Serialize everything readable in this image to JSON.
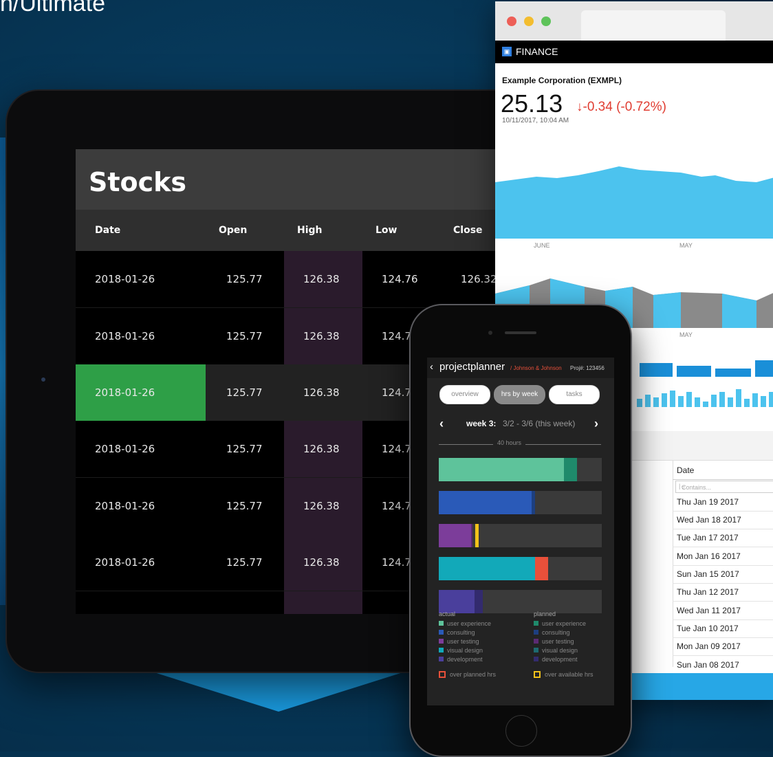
{
  "headline": "n/Ultimate",
  "tablet": {
    "title": "Stocks",
    "columns": [
      "Date",
      "Open",
      "High",
      "Low",
      "Close"
    ],
    "rows": [
      {
        "date": "2018-01-26",
        "open": "125.77",
        "high": "126.38",
        "low": "124.76",
        "close": "126.32"
      },
      {
        "date": "2018-01-26",
        "open": "125.77",
        "high": "126.38",
        "low": "124.76"
      },
      {
        "date": "2018-01-26",
        "open": "125.77",
        "high": "126.38",
        "low": "124.76"
      },
      {
        "date": "2018-01-26",
        "open": "125.77",
        "high": "126.38",
        "low": "124.76"
      },
      {
        "date": "2018-01-26",
        "open": "125.77",
        "high": "126.38",
        "low": "124.76"
      },
      {
        "date": "2018-01-26",
        "open": "125.77",
        "high": "126.38",
        "low": "124.76"
      }
    ],
    "selected_row": 2,
    "colors": {
      "selected": "#2e9f47",
      "high_column": "#2a1b2c"
    }
  },
  "browser": {
    "app_icon": "finance-logo-icon",
    "app_name": "FINANCE",
    "company": "Example Corporation (EXMPL)",
    "price": "25.13",
    "change_arrow": "↓",
    "change": "-0.34 (-0.72%)",
    "timestamp": "10/11/2017, 10:04 AM",
    "month_labels": {
      "top_left": "JUNE",
      "top_right": "MAY",
      "bottom": "MAY"
    },
    "grid": {
      "column": "Date",
      "filter_icon": "filter-icon",
      "filter_placeholder": "Contains...",
      "dates": [
        "Thu Jan 19 2017",
        "Wed Jan 18 2017",
        "Tue Jan 17 2017",
        "Mon Jan 16 2017",
        "Sun Jan 15 2017",
        "Thu Jan 12 2017",
        "Wed Jan 11 2017",
        "Tue Jan 10 2017",
        "Mon Jan 09 2017",
        "Sun Jan 08 2017"
      ]
    },
    "colors": {
      "chart": "#4cc3ee",
      "negative": "#e03c31",
      "footer": "#27a7e6"
    }
  },
  "phone": {
    "app_title": "projectplanner",
    "client": "/ Johnson & Johnson",
    "project": "Proj#: 123456",
    "tabs": [
      "overview",
      "hrs by week",
      "tasks"
    ],
    "active_tab": 1,
    "week_label": "week 3:",
    "week_range": "3/2 - 3/6 (this week)",
    "capacity_label": "40 hours",
    "bars": [
      {
        "actual": 0.77,
        "planned_end": 0.85,
        "actual_color": "#5ec39b",
        "planned_color": "#1f8a6b"
      },
      {
        "actual": 0.57,
        "planned_end": 0.59,
        "actual_color": "#2a5ab8",
        "planned_color": "#1d3f80"
      },
      {
        "actual": 0.2,
        "planned_end": 0.21,
        "actual_color": "#7c3d9a",
        "planned_color": "#5b2a73",
        "overflow_color": "#f2c21a"
      },
      {
        "actual": 0.59,
        "planned_end": 0.67,
        "actual_color": "#12a9b9",
        "planned_color": "#e8503a"
      },
      {
        "actual": 0.22,
        "planned_end": 0.27,
        "actual_color": "#4a3f9c",
        "planned_color": "#332b6e"
      }
    ],
    "legend": {
      "actual_title": "actual",
      "planned_title": "planned",
      "items": [
        {
          "label": "user experience",
          "actual": "#5ec39b",
          "planned": "#1f8a6b"
        },
        {
          "label": "consulting",
          "actual": "#2a5ab8",
          "planned": "#1d3f80"
        },
        {
          "label": "user testing",
          "actual": "#7c3d9a",
          "planned": "#5b2a73"
        },
        {
          "label": "visual design",
          "actual": "#12a9b9",
          "planned": "#1d6a70"
        },
        {
          "label": "development",
          "actual": "#4a3f9c",
          "planned": "#332b6e"
        }
      ],
      "over_planned": "over planned hrs",
      "over_available": "over available hrs",
      "over_planned_color": "#e8503a",
      "over_available_color": "#f2c21a"
    }
  }
}
